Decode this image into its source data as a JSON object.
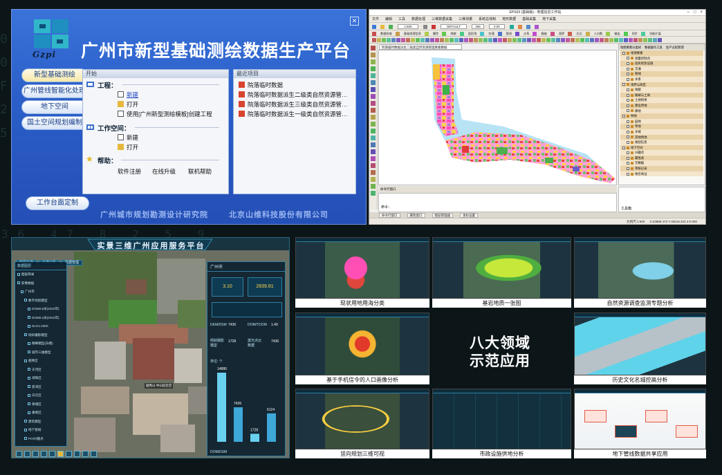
{
  "backdrop": {
    "rows": [
      "0 9",
      "0  4",
      "F  0",
      "2 9",
      "5 F",
      "36 47 8 2 5 9"
    ]
  },
  "launcher": {
    "title": "广州市新型基础测绘数据生产平台",
    "logo_text": "Gzpi",
    "sidebar": [
      "新型基础测绘",
      "广州管线智能化处理",
      "地下空间",
      "国土空间规划编制"
    ],
    "start_header": "开始",
    "recent_header": "最近项目",
    "project_label": "工程：",
    "project_items": [
      "新建",
      "打开",
      "使用[广州新型测绘模板]创建工程"
    ],
    "workspace_label": "工作空间：",
    "workspace_items": [
      "新建",
      "打开"
    ],
    "help_label": "帮助：",
    "help_items": [
      "软件注册",
      "在线升级",
      "联机帮助"
    ],
    "recent_items": [
      "院落临时数据",
      "院落临时数据派生二级类自然资源管…",
      "院落临时数据派生三级类自然资源管…",
      "院落临时数据派生一级类自然资源管…"
    ],
    "customize_button": "工作台面定制",
    "footer_org1": "广州城市规划勘测设计研究院",
    "footer_org2": "北京山维科技股份有限公司",
    "close_icon": "close-icon"
  },
  "gis": {
    "window_title": "EPS03 (基础版) - 地理信息工作站",
    "window_buttons": [
      "–",
      "□",
      "×"
    ],
    "menu": [
      "文件",
      "编辑",
      "工具",
      "数据处理",
      "三维数据采集",
      "三维测量",
      "系统总体制",
      "地形数据",
      "基础采集",
      "地下采集"
    ],
    "toolbar1": [
      "1:500",
      "DEFAULT",
      "256",
      "0.00"
    ],
    "toolbar2": [
      "数据检查",
      "基础地理信息",
      "属性",
      "地貌",
      "居民地",
      "交通",
      "管线",
      "水系",
      "植被",
      "境界",
      "注记",
      "人口数",
      "输出",
      "同步",
      "功能扩展"
    ],
    "doc_tab": "院落临时数据派生二级类自然资源管理要素数据",
    "right_panel_tabs": [
      "地图要素分类树",
      "数据操作工具",
      "生产过程管理"
    ],
    "layer_tree": [
      "地理要素",
      "测量控制点",
      "居民地及设施",
      "交通",
      "管线",
      "水系",
      "境界与政区",
      "地貌",
      "植被与土质",
      "土地利用",
      "建设用地",
      "耕地",
      "林地",
      "园地",
      "草地",
      "水域",
      "其他用地",
      "规划信息",
      "地下空间",
      "兴趣点",
      "属性表",
      "元数据",
      "审核记录",
      "地名地址"
    ],
    "bottom_panel_title": "命令行窗口",
    "command_label": "命令：",
    "bottom_tabs": [
      "命令行窗口",
      "属性窗口",
      "图层管理器",
      "坐标设置"
    ],
    "tool_panel_label": "工具箱",
    "status_coords": "X:23888.473  Y:49218.343  Z:0.000",
    "status_scale": "比例尺:1:500"
  },
  "scene3d": {
    "title": "实景三维广州应用服务平台",
    "top_tabs": [
      "实景三维",
      "三维分析",
      "数据管理"
    ],
    "left_panel_title": "数据图层",
    "left_tree": [
      "图层目录",
      "影像数据",
      "广州市",
      "数字高程模型",
      "DOM0.5米(2022年)",
      "DOM0.2米(2022年)",
      "DLG1:2000",
      "倾斜摄影模型",
      "精细模型(白模)",
      "城市三维模型",
      "越秀区",
      "天河区",
      "海珠区",
      "荔湾区",
      "白云区",
      "黄埔区",
      "番禺区",
      "建筑模型",
      "地下管线",
      "POI兴趣点"
    ],
    "stats_title": "广州市",
    "stats": {
      "a_value": "3.10",
      "b_value": "2839.81",
      "dem_label": "DEM/DSM",
      "dem_value": "7436",
      "dom_label": "DOM/TDOM",
      "dom_value": "1.49",
      "c_label": "倾斜摄影模型",
      "c_value": "1728",
      "d_label": "激光点云数据",
      "d_value": "7436"
    },
    "chart_label": "单位: 个",
    "chart_axis_label": "DOM/DSM",
    "bar_values": [
      14880,
      7436,
      1728,
      6124
    ],
    "bar_labels": [
      "14880",
      "7436",
      "1728",
      "6124"
    ],
    "building_label": "越秀山 中山纪念堂"
  },
  "showcase": {
    "center_line1": "八大领域",
    "center_line2": "示范应用",
    "captions": [
      "现状用地用海分类",
      "基岩地质一张图",
      "自然资源调查监测专题分析",
      "基于手机信令的人口画像分析",
      "历史文化名城控高分析",
      "竖向规划三维可视",
      "市政设施供地分析",
      "地下管线数据共享应用"
    ]
  },
  "colors": {
    "launcher_blue": "#2b5fc9",
    "dark_bg": "#0c1518",
    "accent_cyan": "#2f7fa3",
    "land_pink": "#ff66cc",
    "land_yellow": "#ffd23f"
  }
}
